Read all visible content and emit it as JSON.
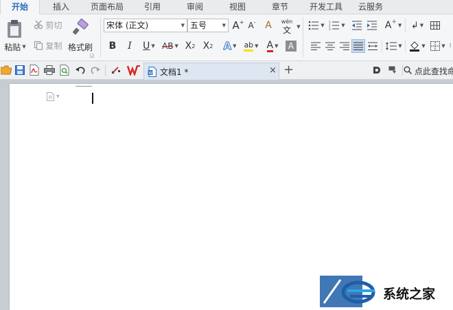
{
  "tabs": [
    {
      "label": "开始",
      "active": true
    },
    {
      "label": "插入"
    },
    {
      "label": "页面布局"
    },
    {
      "label": "引用"
    },
    {
      "label": "审阅"
    },
    {
      "label": "视图"
    },
    {
      "label": "章节"
    },
    {
      "label": "开发工具"
    },
    {
      "label": "云服务"
    }
  ],
  "ribbon": {
    "paste": "粘贴",
    "cut": "剪切",
    "copy": "复制",
    "format_painter": "格式刷",
    "font_name": "宋体 (正文)",
    "font_size": "五号",
    "bold": "B",
    "italic": "I",
    "underline": "U",
    "strikethrough": "AB",
    "superscript_base": "X",
    "superscript": "2",
    "subscript_base": "X",
    "subscript": "2",
    "grow_font": "A",
    "shrink_font": "A",
    "clear_format": "A",
    "phonetic_top": "wén",
    "phonetic_bottom": "文",
    "font_color": "A",
    "char_shading": "A",
    "text_effect": "A",
    "highlight": "ab"
  },
  "document_tab": {
    "title": "文档1 *",
    "close": "×"
  },
  "new_tab": "+",
  "search_label": "点此查找命",
  "colors": {
    "accent": "#2b6cc0",
    "font_color_underline": "#d22222",
    "highlight_underline": "#f4e000",
    "doc_tab_bg": "#dde6f1",
    "wps_red": "#d9221c"
  },
  "watermark": {
    "text": "系统之家"
  }
}
